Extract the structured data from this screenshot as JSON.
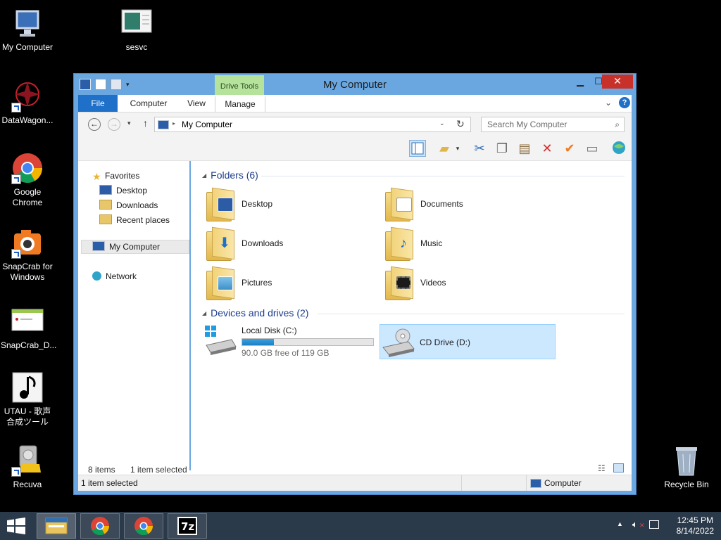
{
  "desktop": {
    "icons": [
      {
        "label": "My Computer"
      },
      {
        "label": "sesvc"
      },
      {
        "label": "DataWagon..."
      },
      {
        "label": "Google Chrome"
      },
      {
        "label": "SnapCrab for Windows"
      },
      {
        "label": "SnapCrab_D..."
      },
      {
        "label": "UTAU - 歌声合成ツール"
      },
      {
        "label": "Recuva"
      },
      {
        "label": "Recycle Bin"
      }
    ]
  },
  "window": {
    "title": "My Computer",
    "context_tab": "Drive Tools",
    "ribbon_tabs": [
      "File",
      "Computer",
      "View",
      "Manage"
    ],
    "address": "My Computer",
    "search_placeholder": "Search My Computer",
    "nav": {
      "favorites": "Favorites",
      "desktop": "Desktop",
      "downloads": "Downloads",
      "recent": "Recent places",
      "computer": "My Computer",
      "network": "Network"
    },
    "groups": {
      "folders": "Folders (6)",
      "devices": "Devices and drives (2)"
    },
    "folders": [
      "Desktop",
      "Documents",
      "Downloads",
      "Music",
      "Pictures",
      "Videos"
    ],
    "drives": {
      "c_name": "Local Disk (C:)",
      "c_free": "90.0 GB free of 119 GB",
      "c_used_fraction": 0.24,
      "d_name": "CD Drive (D:)"
    },
    "status": {
      "count": "8 items",
      "selected": "1 item selected",
      "bottom_left": "1 item selected",
      "bottom_right": "Computer"
    }
  },
  "taskbar": {
    "time": "12:45 PM",
    "date": "8/14/2022"
  }
}
